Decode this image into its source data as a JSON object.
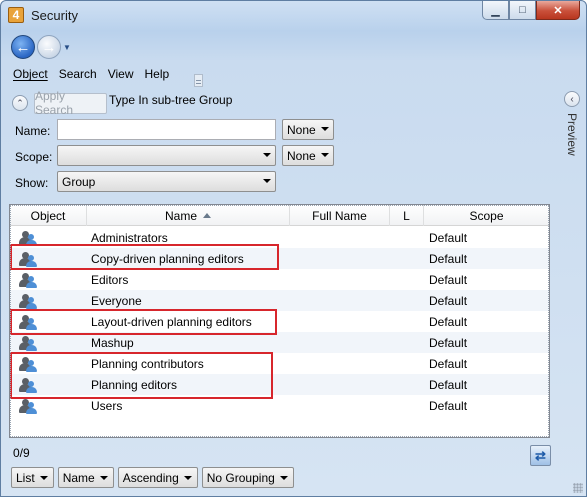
{
  "window": {
    "title": "Security",
    "app_icon_text": "4"
  },
  "titlebar_buttons": {
    "minimize": "▁",
    "maximize": "□",
    "close": "✕"
  },
  "menu": [
    "Object",
    "Search",
    "View",
    "Help"
  ],
  "search": {
    "apply_label": "Apply Search",
    "type_label": "Type In sub-tree Group",
    "name_label": "Name:",
    "name_value": "",
    "name_mode": "None",
    "scope_label": "Scope:",
    "scope_value": "",
    "scope_mode": "None",
    "show_label": "Show:",
    "show_value": "Group"
  },
  "preview_panel": {
    "label": "Preview"
  },
  "table": {
    "columns": [
      "Object",
      "Name",
      "Full Name",
      "L",
      "Scope"
    ],
    "sort_column": "Name",
    "sort_direction": "ascending",
    "rows": [
      {
        "name": "Administrators",
        "full_name": "",
        "l": "",
        "scope": "Default",
        "icon": "user-group-icon"
      },
      {
        "name": "Copy-driven planning editors",
        "full_name": "",
        "l": "",
        "scope": "Default",
        "icon": "user-group-icon"
      },
      {
        "name": "Editors",
        "full_name": "",
        "l": "",
        "scope": "Default",
        "icon": "user-group-icon"
      },
      {
        "name": "Everyone",
        "full_name": "",
        "l": "",
        "scope": "Default",
        "icon": "user-group-icon"
      },
      {
        "name": "Layout-driven planning editors",
        "full_name": "",
        "l": "",
        "scope": "Default",
        "icon": "user-group-icon"
      },
      {
        "name": "Mashup",
        "full_name": "",
        "l": "",
        "scope": "Default",
        "icon": "user-group-icon"
      },
      {
        "name": "Planning contributors",
        "full_name": "",
        "l": "",
        "scope": "Default",
        "icon": "user-group-icon"
      },
      {
        "name": "Planning editors",
        "full_name": "",
        "l": "",
        "scope": "Default",
        "icon": "user-group-icon"
      },
      {
        "name": "Users",
        "full_name": "",
        "l": "",
        "scope": "Default",
        "icon": "user-group-icon"
      }
    ]
  },
  "status": {
    "count": "0/9"
  },
  "bottom": {
    "view": "List",
    "sort_by": "Name",
    "order": "Ascending",
    "grouping": "No Grouping"
  },
  "colors": {
    "highlight_box": "#d7262c",
    "accent": "#2a66c4"
  }
}
